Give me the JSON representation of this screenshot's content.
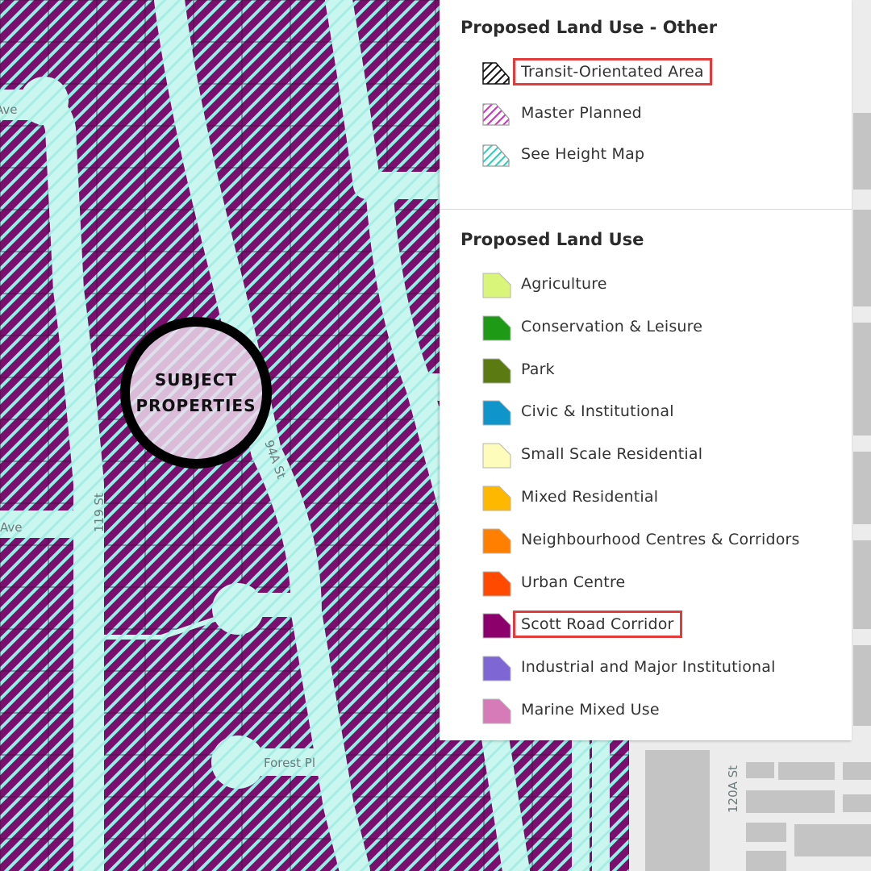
{
  "map": {
    "streets": {
      "ave_top": "Ave",
      "ave_mid": "Ave",
      "st_119": "119 St",
      "st_94a": "94A St",
      "forest_pl": "Forest Pl",
      "st_120a": "120A St"
    },
    "subject": {
      "line1": "SUBJECT",
      "line2": "PROPERTIES"
    },
    "colors": {
      "scott_road_fill": "#7b0f6e",
      "height_map_hatch": "#8ff0e4",
      "road_fill": "#c9f7ef"
    }
  },
  "legend": {
    "other": {
      "title": "Proposed Land Use - Other",
      "items": [
        {
          "label": "Transit-Orientated Area",
          "pattern": "hatch-black",
          "highlighted": true
        },
        {
          "label": "Master Planned",
          "pattern": "hatch-magenta",
          "highlighted": false
        },
        {
          "label": "See Height Map",
          "pattern": "hatch-cyan",
          "highlighted": false
        }
      ]
    },
    "main": {
      "title": "Proposed Land Use",
      "items": [
        {
          "label": "Agriculture",
          "color": "#d9f57a"
        },
        {
          "label": "Conservation & Leisure",
          "color": "#1f9a16"
        },
        {
          "label": "Park",
          "color": "#5b7a12"
        },
        {
          "label": "Civic & Institutional",
          "color": "#0f95c9"
        },
        {
          "label": "Small Scale Residential",
          "color": "#fdfcba"
        },
        {
          "label": "Mixed Residential",
          "color": "#ffb800"
        },
        {
          "label": "Neighbourhood Centres & Corridors",
          "color": "#ff7f00"
        },
        {
          "label": "Urban Centre",
          "color": "#ff4a00"
        },
        {
          "label": "Scott Road Corridor",
          "color": "#8b006b",
          "highlighted": true
        },
        {
          "label": "Industrial and Major Institutional",
          "color": "#7e66d4"
        },
        {
          "label": "Marine Mixed Use",
          "color": "#d77ab8"
        }
      ]
    }
  }
}
